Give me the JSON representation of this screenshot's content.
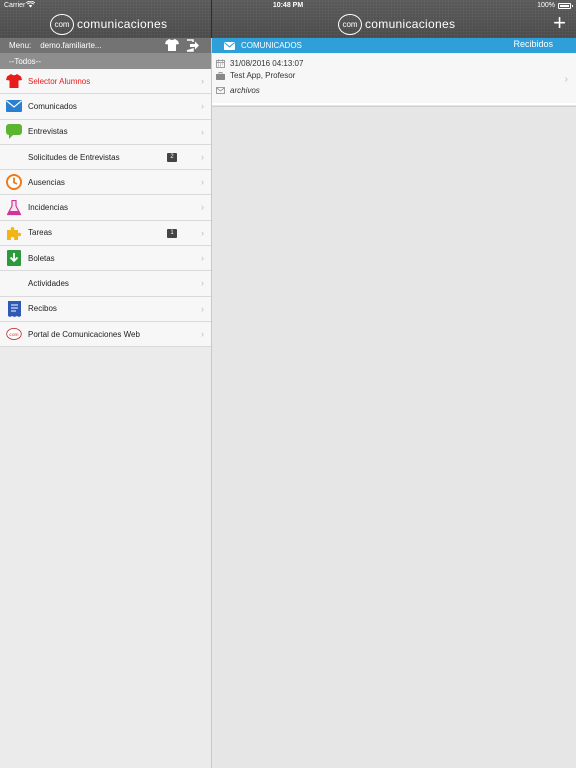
{
  "status_bar": {
    "carrier": "Carrier",
    "time": "10:48 PM",
    "battery": "100%"
  },
  "brand": {
    "badge": "com",
    "name": "comunicaciones"
  },
  "sidebar": {
    "menu_label": "Menu:",
    "user": "demo.familiarte...",
    "filter": "--Todos--",
    "items": [
      {
        "label": "Selector Alumnos",
        "icon": "shirt-icon",
        "active": true
      },
      {
        "label": "Comunicados",
        "icon": "envelope-icon"
      },
      {
        "label": "Entrevistas",
        "icon": "speech-bubble-icon"
      },
      {
        "label": "Solicitudes de Entrevistas",
        "icon": "",
        "count": "2"
      },
      {
        "label": "Ausencias",
        "icon": "clock-icon"
      },
      {
        "label": "Incidencias",
        "icon": "flask-icon"
      },
      {
        "label": "Tareas",
        "icon": "puzzle-icon",
        "count": "1"
      },
      {
        "label": "Boletas",
        "icon": "download-icon"
      },
      {
        "label": "Actividades",
        "icon": ""
      },
      {
        "label": "Recibos",
        "icon": "receipt-icon"
      },
      {
        "label": "Portal de Comunicaciones Web",
        "icon": "com-logo-icon"
      }
    ]
  },
  "main": {
    "section_title": "COMUNICADOS",
    "folder": "Recibidos",
    "message": {
      "date": "31/08/2016 04:13:07",
      "sender": "Test App, Profesor",
      "attachments": "archivos"
    }
  },
  "colors": {
    "accent": "#2e9fd8",
    "active": "#e81b1b",
    "header": "#525252"
  }
}
